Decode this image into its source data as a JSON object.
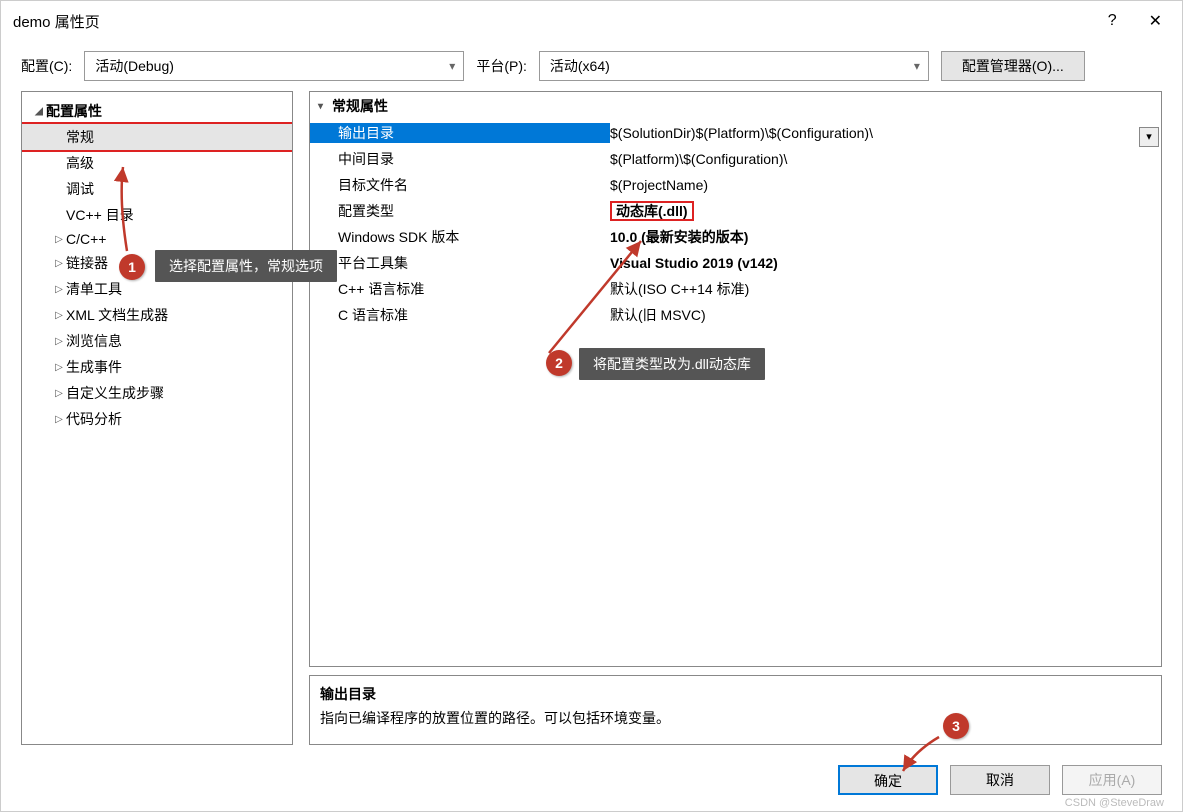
{
  "title": "demo 属性页",
  "help": "?",
  "toolbar": {
    "config_label": "配置(C):",
    "config_value": "活动(Debug)",
    "platform_label": "平台(P):",
    "platform_value": "活动(x64)",
    "config_mgr": "配置管理器(O)..."
  },
  "tree": {
    "root": "配置属性",
    "items": [
      {
        "label": "常规",
        "selected": true,
        "redbox": true
      },
      {
        "label": "高级"
      },
      {
        "label": "调试"
      },
      {
        "label": "VC++ 目录"
      },
      {
        "label": "C/C++",
        "expandable": true
      },
      {
        "label": "链接器",
        "expandable": true
      },
      {
        "label": "清单工具",
        "expandable": true
      },
      {
        "label": "XML 文档生成器",
        "expandable": true
      },
      {
        "label": "浏览信息",
        "expandable": true
      },
      {
        "label": "生成事件",
        "expandable": true
      },
      {
        "label": "自定义生成步骤",
        "expandable": true
      },
      {
        "label": "代码分析",
        "expandable": true
      }
    ]
  },
  "grid": {
    "group": "常规属性",
    "rows": [
      {
        "name": "输出目录",
        "value": "$(SolutionDir)$(Platform)\\$(Configuration)\\",
        "selected": true
      },
      {
        "name": "中间目录",
        "value": "$(Platform)\\$(Configuration)\\"
      },
      {
        "name": "目标文件名",
        "value": "$(ProjectName)"
      },
      {
        "name": "配置类型",
        "value": "动态库(.dll)",
        "bold": true,
        "redbox": true
      },
      {
        "name": "Windows SDK 版本",
        "value": "10.0 (最新安装的版本)",
        "bold": true
      },
      {
        "name": "平台工具集",
        "value": "Visual Studio 2019 (v142)",
        "bold": true
      },
      {
        "name": "C++ 语言标准",
        "value": "默认(ISO C++14 标准)"
      },
      {
        "name": "C 语言标准",
        "value": "默认(旧 MSVC)"
      }
    ]
  },
  "desc": {
    "title": "输出目录",
    "body": "指向已编译程序的放置位置的路径。可以包括环境变量。"
  },
  "footer": {
    "ok": "确定",
    "cancel": "取消",
    "apply": "应用(A)"
  },
  "annotations": {
    "callout1": "选择配置属性，常规选项",
    "callout2": "将配置类型改为.dll动态库",
    "badge1": "1",
    "badge2": "2",
    "badge3": "3"
  },
  "watermark": "CSDN @SteveDraw"
}
